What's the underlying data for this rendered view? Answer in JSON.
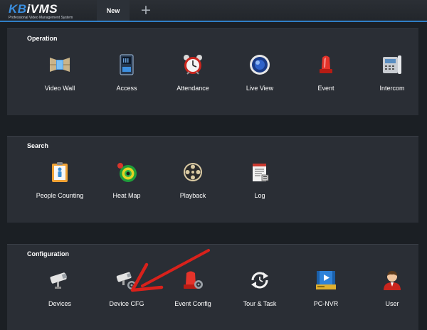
{
  "app": {
    "logo_text_kb": "KB",
    "logo_text_rest": "iVMS",
    "logo_subtitle": "Professional Video Management System"
  },
  "tabs": {
    "active": "New",
    "add_icon": "plus-icon"
  },
  "sections": [
    {
      "title": "Operation",
      "items": [
        {
          "label": "Video Wall",
          "icon": "video-wall-icon"
        },
        {
          "label": "Access",
          "icon": "access-control-icon"
        },
        {
          "label": "Attendance",
          "icon": "alarm-clock-icon"
        },
        {
          "label": "Live View",
          "icon": "live-view-icon"
        },
        {
          "label": "Event",
          "icon": "alarm-light-icon"
        },
        {
          "label": "Intercom",
          "icon": "intercom-phone-icon"
        }
      ]
    },
    {
      "title": "Search",
      "items": [
        {
          "label": "People Counting",
          "icon": "people-counting-icon"
        },
        {
          "label": "Heat Map",
          "icon": "heat-map-icon"
        },
        {
          "label": "Playback",
          "icon": "film-reel-icon"
        },
        {
          "label": "Log",
          "icon": "log-document-icon"
        }
      ]
    },
    {
      "title": "Configuration",
      "items": [
        {
          "label": "Devices",
          "icon": "camera-icon"
        },
        {
          "label": "Device CFG",
          "icon": "camera-settings-icon"
        },
        {
          "label": "Event Config",
          "icon": "alarm-settings-icon"
        },
        {
          "label": "Tour & Task",
          "icon": "refresh-clock-icon"
        },
        {
          "label": "PC-NVR",
          "icon": "pc-nvr-icon"
        },
        {
          "label": "User",
          "icon": "user-icon"
        }
      ]
    }
  ],
  "colors": {
    "accent": "#2f7fc6",
    "panel_bg": "#2a2e35",
    "page_bg": "#1b1f24",
    "annotation_arrow": "#d9211b"
  }
}
